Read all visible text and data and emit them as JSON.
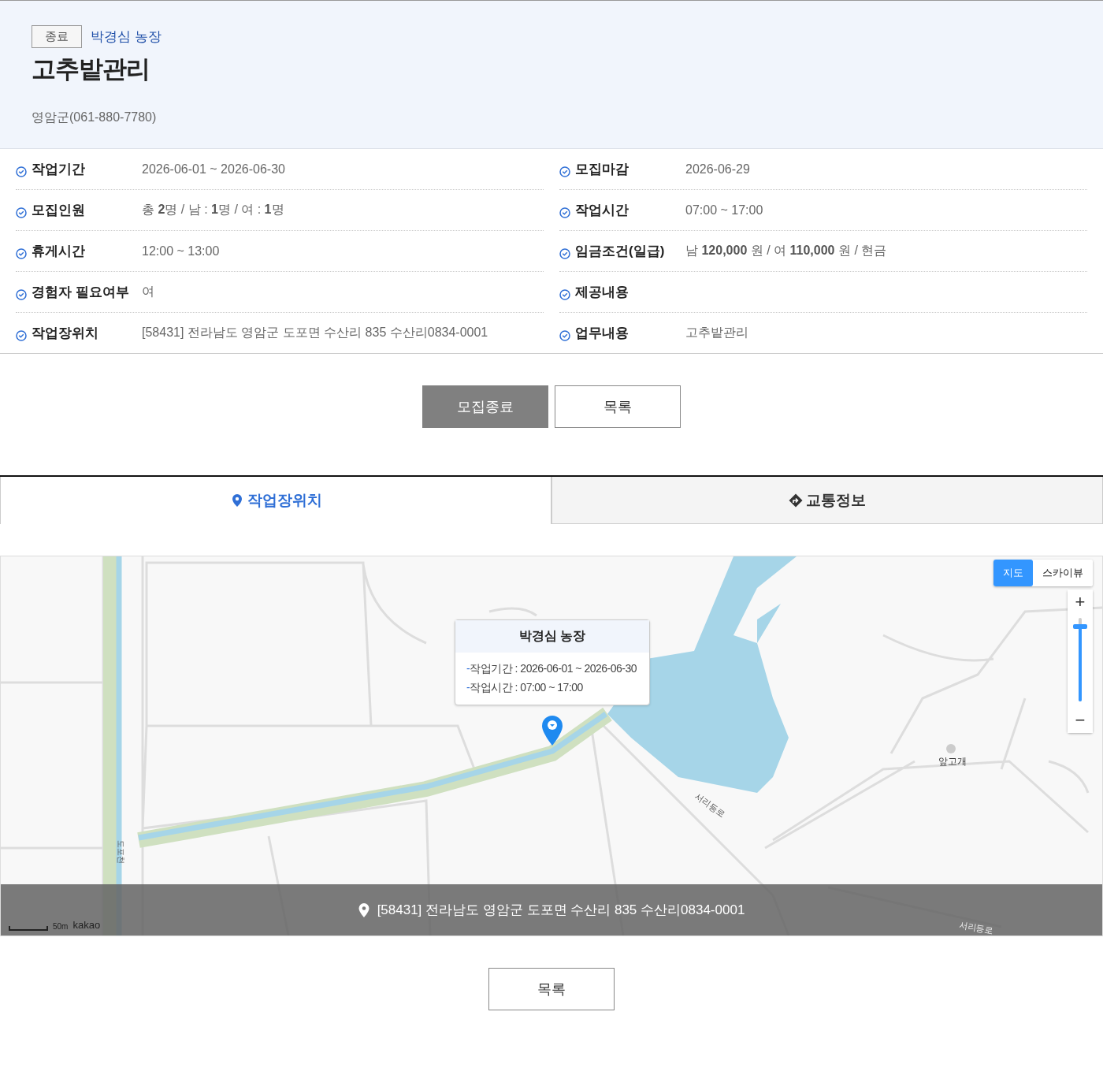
{
  "header": {
    "status_badge": "종료",
    "farm_name": "박경심 농장",
    "title": "고추밭관리",
    "contact": "영암군(061-880-7780)"
  },
  "details": [
    {
      "label": "작업기간",
      "value": "2026-06-01 ~ 2026-06-30"
    },
    {
      "label": "모집마감",
      "value": "2026-06-29"
    },
    {
      "label": "모집인원",
      "value": "총 **2**명 / 남 : **1**명 / 여 : **1**명"
    },
    {
      "label": "작업시간",
      "value": "07:00 ~ 17:00"
    },
    {
      "label": "휴게시간",
      "value": "12:00 ~ 13:00"
    },
    {
      "label": "임금조건(일급)",
      "value": "남 **120,000** 원 / 여 **110,000** 원 / 현금"
    },
    {
      "label": "경험자 필요여부",
      "value": "여"
    },
    {
      "label": "제공내용"
    },
    {
      "label": "작업장위치",
      "value": "[58431] 전라남도 영암군 도포면 수산리 835 수산리0834-0001"
    },
    {
      "label": "업무내용",
      "value": "고추밭관리"
    }
  ],
  "actions": [
    {
      "label": "모집종료",
      "kind": "primary"
    },
    {
      "label": "목록",
      "kind": "outline"
    }
  ],
  "tabs": [
    {
      "label": "작업장위치",
      "kind": "pin",
      "selected": true
    },
    {
      "label": "교통정보",
      "kind": "directions",
      "selected": false
    }
  ],
  "map": {
    "layer_buttons": [
      {
        "label": "지도",
        "selected": true
      },
      {
        "label": "스카이뷰",
        "selected": false
      }
    ],
    "zoom": {
      "plus": "+",
      "minus": "−",
      "level": 0.9
    },
    "labels": [
      {
        "text": "도포천",
        "kind": "stream"
      },
      {
        "text": "서리등로",
        "kind": "road"
      },
      {
        "text": "서리등로",
        "kind": "road2"
      },
      {
        "text": "앞고개",
        "kind": "place"
      }
    ],
    "info_window": {
      "title": "박경심 농장",
      "lines": [
        {
          "bullet": "-",
          "text": "작업기간 : 2026-06-01 ~ 2026-06-30"
        },
        {
          "bullet": "-",
          "text": "작업시간 : 07:00 ~ 17:00"
        }
      ]
    },
    "scale": "50m",
    "brand": "kakao",
    "address": "[58431] 전라남도 영암군 도포면 수산리 835 수산리0834-0001"
  },
  "footer_button": "목록"
}
